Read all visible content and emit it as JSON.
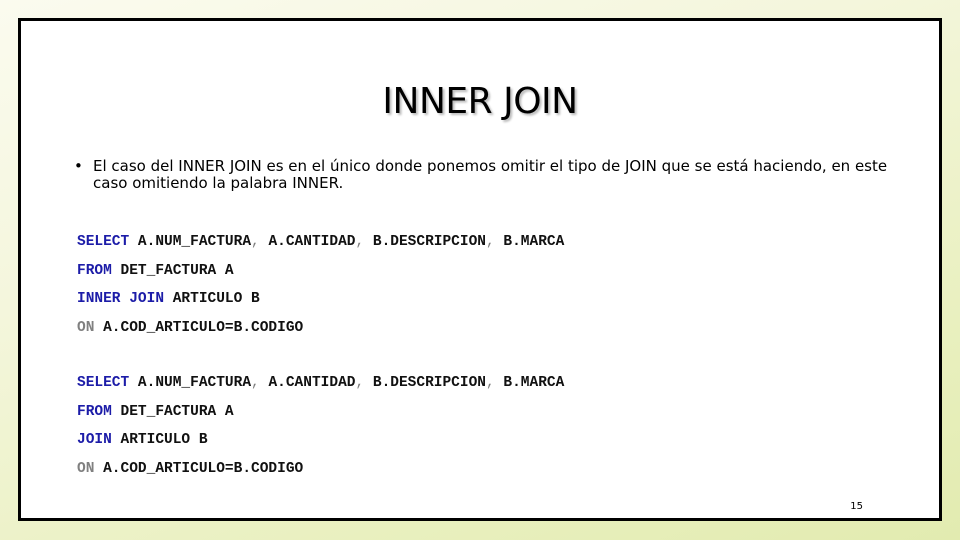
{
  "slide": {
    "title": "INNER JOIN",
    "bullet": {
      "symbol": "•",
      "text": "El caso del INNER JOIN es en el único donde ponemos omitir el tipo de JOIN que se está haciendo, en este caso omitiendo la palabra INNER."
    },
    "query1": {
      "line1": {
        "kw": "SELECT",
        "a": " A.NUM_FACTURA",
        "c1": ",",
        "b": " A.CANTIDAD",
        "c2": ",",
        "c": " B.DESCRIPCION",
        "c3": ",",
        "d": " B.MARCA"
      },
      "line2": {
        "kw": "FROM",
        "rest": " DET_FACTURA A"
      },
      "line3": {
        "kw": "INNER JOIN",
        "rest": " ARTICULO B"
      },
      "line4": {
        "kw": "ON",
        "rest": " A.COD_ARTICULO=B.CODIGO"
      }
    },
    "query2": {
      "line1": {
        "kw": "SELECT",
        "a": " A.NUM_FACTURA",
        "c1": ",",
        "b": " A.CANTIDAD",
        "c2": ",",
        "c": " B.DESCRIPCION",
        "c3": ",",
        "d": " B.MARCA"
      },
      "line2": {
        "kw": "FROM",
        "rest": " DET_FACTURA A"
      },
      "line3": {
        "kw": "JOIN",
        "rest": " ARTICULO B"
      },
      "line4": {
        "kw": "ON",
        "rest": " A.COD_ARTICULO=B.CODIGO"
      }
    },
    "page_number": "15",
    "colors": {
      "keyword": "#1c1ca8",
      "on_keyword": "#808080",
      "border": "#000000"
    }
  }
}
